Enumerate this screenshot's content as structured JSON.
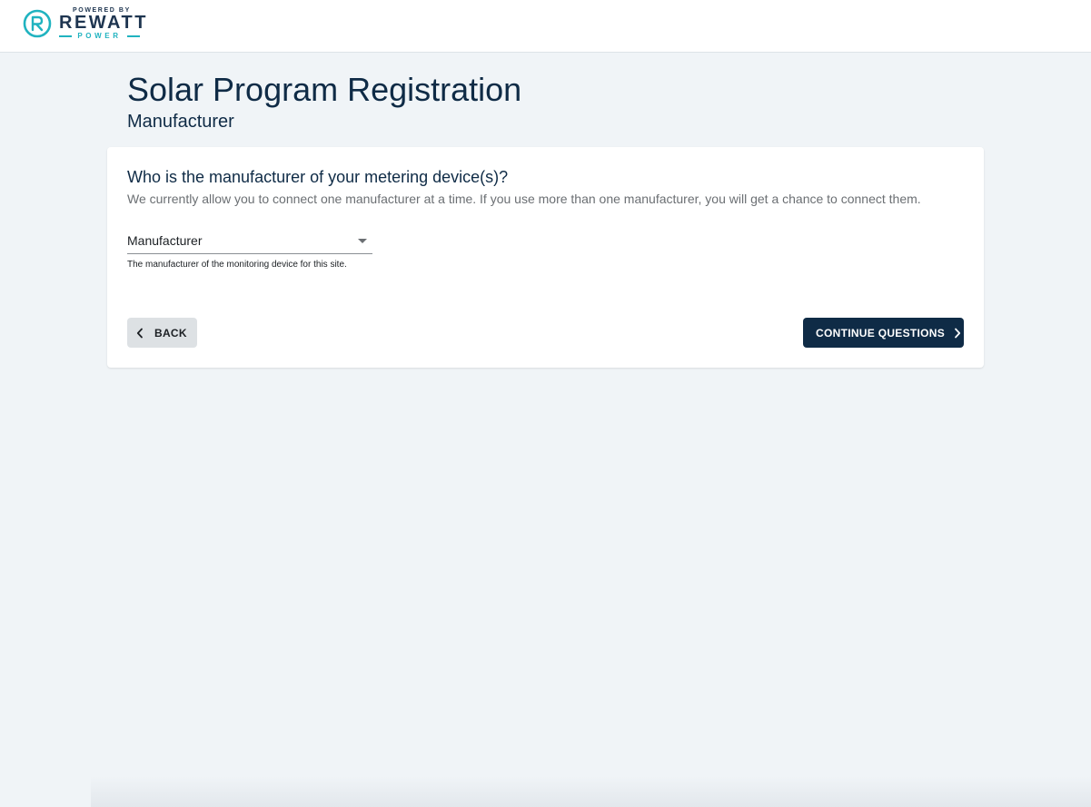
{
  "header": {
    "logo": {
      "powered_by": "POWERED BY",
      "brand": "REWATT",
      "sub": "POWER",
      "icon": "rewatt-r-icon",
      "accent_color": "#20b3c0"
    }
  },
  "page": {
    "title": "Solar Program Registration",
    "subtitle": "Manufacturer"
  },
  "form": {
    "question": "Who is the manufacturer of your metering device(s)?",
    "description": "We currently allow you to connect one manufacturer at a time. If you use more than one manufacturer, you will get a chance to connect them.",
    "manufacturer_select": {
      "value": "Manufacturer",
      "helper": "The manufacturer of the monitoring device for this site.",
      "icon": "caret-down-icon"
    }
  },
  "actions": {
    "back_label": "BACK",
    "back_icon": "chevron-left-icon",
    "continue_label": "CONTINUE QUESTIONS",
    "continue_icon": "chevron-right-icon",
    "primary_color": "#0f2b46"
  }
}
